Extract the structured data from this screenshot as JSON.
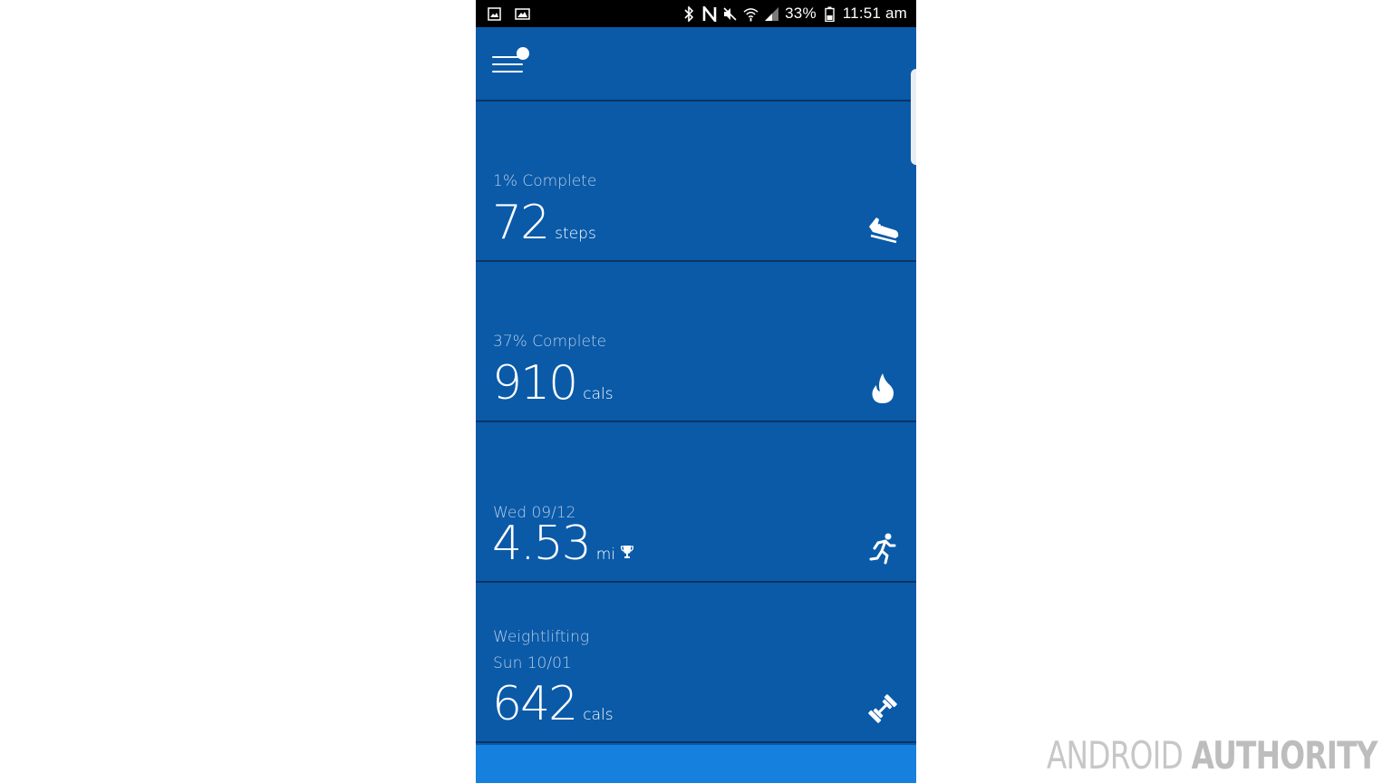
{
  "status_bar": {
    "battery": "33%",
    "time": "11:51 am",
    "icons": [
      "gallery-icon",
      "image-notification-icon",
      "bluetooth-icon",
      "nfc-icon",
      "mute-icon",
      "wifi-icon",
      "signal-icon",
      "battery-icon"
    ]
  },
  "header": {
    "menu_icon": "hamburger-menu-icon"
  },
  "tiles": [
    {
      "subtitle": "1% Complete",
      "value": "72",
      "unit": "steps",
      "icon": "shoe-icon"
    },
    {
      "subtitle": "37% Complete",
      "value": "910",
      "unit": "cals",
      "icon": "flame-icon"
    },
    {
      "subtitle": "Wed 09/12",
      "value": "4.53",
      "unit": "mi",
      "badge_icon": "trophy-icon",
      "icon": "runner-icon"
    },
    {
      "subtitle": "Weightlifting",
      "subtitle2": "Sun 10/01",
      "value": "642",
      "unit": "cals",
      "icon": "dumbbell-icon"
    }
  ],
  "watermark": {
    "part1": "ANDROID",
    "part2": "AUTHORITY"
  },
  "colors": {
    "tile_bg": "#0a5aa8",
    "divider": "#0b3363",
    "accent_tile": "#1580dd",
    "status_bar": "#000000"
  }
}
